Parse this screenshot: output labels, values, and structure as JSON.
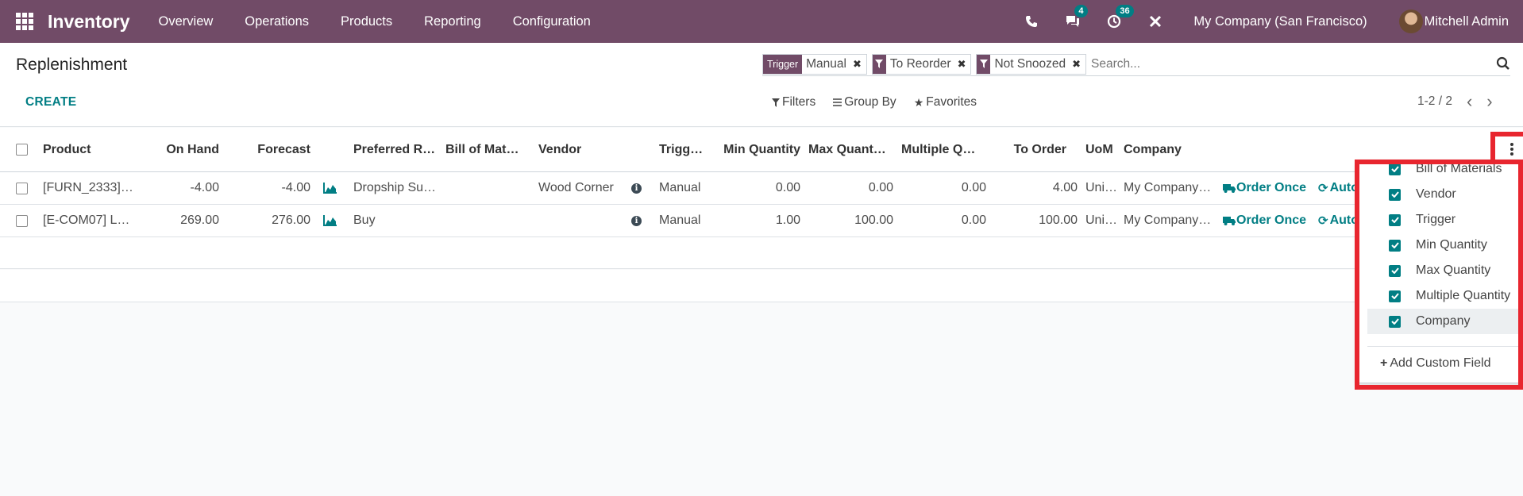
{
  "navbar": {
    "brand": "Inventory",
    "menu": [
      "Overview",
      "Operations",
      "Products",
      "Reporting",
      "Configuration"
    ],
    "messages_count": "4",
    "activities_count": "36",
    "company": "My Company (San Francisco)",
    "user": "Mitchell Admin",
    "color": "#714b67"
  },
  "control": {
    "title": "Replenishment",
    "facets": [
      {
        "label": "Trigger",
        "value": "Manual"
      },
      {
        "value": "To Reorder"
      },
      {
        "value": "Not Snoozed"
      }
    ],
    "search_placeholder": "Search...",
    "create_label": "CREATE",
    "filters_label": "Filters",
    "groupby_label": "Group By",
    "favorites_label": "Favorites",
    "pager": "1-2 / 2"
  },
  "table": {
    "headers": {
      "product": "Product",
      "on_hand": "On Hand",
      "forecast": "Forecast",
      "route": "Preferred R…",
      "bom": "Bill of Mat…",
      "vendor": "Vendor",
      "trigger": "Trigg…",
      "min_qty": "Min Quantity",
      "max_qty": "Max Quant…",
      "multiple": "Multiple Q…",
      "to_order": "To Order",
      "uom": "UoM",
      "company": "Company"
    },
    "rows": [
      {
        "product": "[FURN_2333]…",
        "on_hand": "-4.00",
        "forecast": "-4.00",
        "route": "Dropship Su…",
        "bom": "",
        "vendor": "Wood Corner",
        "trigger": "Manual",
        "min_qty": "0.00",
        "max_qty": "0.00",
        "multiple": "0.00",
        "to_order": "4.00",
        "uom": "Uni…",
        "company": "My Company…",
        "order_once": "Order Once",
        "automate": "Auto"
      },
      {
        "product": "[E-COM07] L…",
        "on_hand": "269.00",
        "forecast": "276.00",
        "route": "Buy",
        "bom": "",
        "vendor": "",
        "trigger": "Manual",
        "min_qty": "1.00",
        "max_qty": "100.00",
        "multiple": "0.00",
        "to_order": "100.00",
        "uom": "Uni…",
        "company": "My Company…",
        "order_once": "Order Once",
        "automate": "Auto"
      }
    ]
  },
  "optional_columns": {
    "items": [
      "Bill of Materials",
      "Vendor",
      "Trigger",
      "Min Quantity",
      "Max Quantity",
      "Multiple Quantity",
      "Company"
    ],
    "add_custom": "Add Custom Field"
  },
  "accent": "#017e84",
  "highlight": "#e8262f"
}
